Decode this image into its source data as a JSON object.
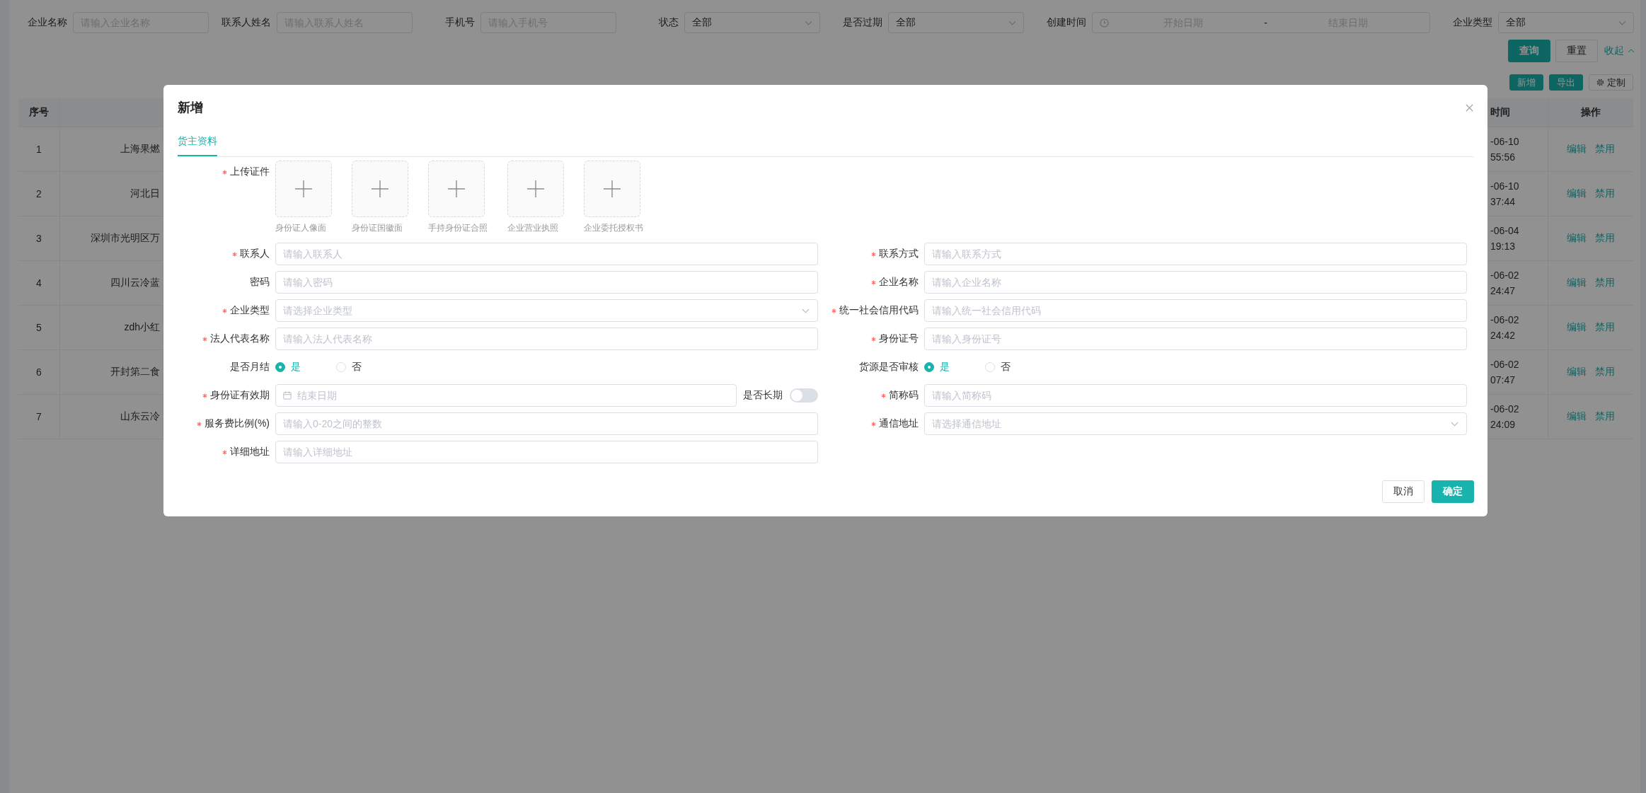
{
  "filters": [
    {
      "kind": "input",
      "label": "企业名称",
      "placeholder": "请输入企业名称"
    },
    {
      "kind": "input",
      "label": "联系人姓名",
      "placeholder": "请输入联系人姓名"
    },
    {
      "kind": "input",
      "label": "手机号",
      "placeholder": "请输入手机号"
    },
    {
      "kind": "select",
      "label": "状态",
      "value": "全部"
    },
    {
      "kind": "select",
      "label": "是否过期",
      "value": "全部"
    },
    {
      "kind": "daterange",
      "label": "创建时间",
      "start_placeholder": "开始日期",
      "separator": "-",
      "end_placeholder": "结束日期"
    },
    {
      "kind": "select",
      "label": "企业类型",
      "value": "全部"
    }
  ],
  "filter_buttons": [
    {
      "kind": "search",
      "label": "查询"
    },
    {
      "kind": "reset",
      "label": "重置"
    },
    {
      "kind": "collapse",
      "label": "收起"
    }
  ],
  "toolbar_buttons": [
    {
      "kind": "add",
      "label": "新增"
    },
    {
      "kind": "export",
      "label": "导出"
    },
    {
      "kind": "customize",
      "label": "定制"
    }
  ],
  "table": {
    "header": {
      "index": "序号",
      "time": "时间",
      "actions": "操作"
    },
    "rows": [
      {
        "index": "1",
        "column_2": "上海果燃",
        "time_lines": [
          "-06-10",
          "55:56"
        ],
        "actions": [
          "编辑",
          "禁用"
        ]
      },
      {
        "index": "2",
        "column_2": "河北日",
        "time_lines": [
          "-06-10",
          "37:44"
        ],
        "actions": [
          "编辑",
          "禁用"
        ]
      },
      {
        "index": "3",
        "column_2": "深圳市光明区万",
        "time_lines": [
          "-06-04",
          "19:13"
        ],
        "actions": [
          "编辑",
          "禁用"
        ]
      },
      {
        "index": "4",
        "column_2": "四川云冷蓝",
        "time_lines": [
          "-06-02",
          "24:47"
        ],
        "actions": [
          "编辑",
          "禁用"
        ]
      },
      {
        "index": "5",
        "column_2": "zdh小红",
        "time_lines": [
          "-06-02",
          "24:42"
        ],
        "actions": [
          "编辑",
          "禁用"
        ]
      },
      {
        "index": "6",
        "column_2": "开封第二食",
        "time_lines": [
          "-06-02",
          "07:47"
        ],
        "actions": [
          "编辑",
          "禁用"
        ]
      },
      {
        "index": "7",
        "column_2": "山东云冷",
        "time_lines": [
          "-06-02",
          "24:09"
        ],
        "actions": [
          "编辑",
          "禁用"
        ]
      }
    ]
  },
  "modal": {
    "title": "新增",
    "tabs": [
      {
        "label": "货主资料",
        "selected": true
      }
    ],
    "upload": {
      "label": "上传证件",
      "required": true,
      "slots": [
        "身份证人像面",
        "身份证国徽面",
        "手持身份证合照",
        "企业营业执照",
        "企业委托授权书"
      ]
    },
    "left_fields": [
      {
        "kind": "input",
        "label": "联系人",
        "required": true,
        "placeholder": "请输入联系人"
      },
      {
        "kind": "input",
        "label": "密码",
        "required": false,
        "placeholder": "请输入密码"
      },
      {
        "kind": "select",
        "label": "企业类型",
        "required": true,
        "placeholder": "请选择企业类型"
      },
      {
        "kind": "input",
        "label": "法人代表名称",
        "required": true,
        "placeholder": "请输入法人代表名称"
      },
      {
        "kind": "radio",
        "label": "是否月结",
        "required": false,
        "options": [
          {
            "label": "是",
            "selected": true
          },
          {
            "label": "否",
            "selected": false
          }
        ]
      },
      {
        "kind": "date",
        "label": "身份证有效期",
        "required": true,
        "placeholder": "结束日期",
        "switch": {
          "label": "是否长期",
          "on": false
        }
      },
      {
        "kind": "input",
        "label": "服务费比例(%)",
        "required": true,
        "placeholder": "请输入0-20之间的整数"
      },
      {
        "kind": "input",
        "label": "详细地址",
        "required": true,
        "placeholder": "请输入详细地址"
      }
    ],
    "right_fields": [
      {
        "kind": "input",
        "label": "联系方式",
        "required": true,
        "placeholder": "请输入联系方式"
      },
      {
        "kind": "input",
        "label": "企业名称",
        "required": true,
        "placeholder": "请输入企业名称"
      },
      {
        "kind": "input",
        "label": "统一社会信用代码",
        "required": true,
        "placeholder": "请输入统一社会信用代码"
      },
      {
        "kind": "input",
        "label": "身份证号",
        "required": true,
        "placeholder": "请输入身份证号"
      },
      {
        "kind": "radio",
        "label": "货源是否审核",
        "required": false,
        "options": [
          {
            "label": "是",
            "selected": true
          },
          {
            "label": "否",
            "selected": false
          }
        ]
      },
      {
        "kind": "input",
        "label": "简称码",
        "required": true,
        "placeholder": "请输入简称码"
      },
      {
        "kind": "select",
        "label": "通信地址",
        "required": true,
        "placeholder": "请选择通信地址"
      }
    ],
    "buttons": [
      {
        "kind": "cancel",
        "label": "取消"
      },
      {
        "kind": "confirm",
        "label": "确定"
      }
    ]
  }
}
